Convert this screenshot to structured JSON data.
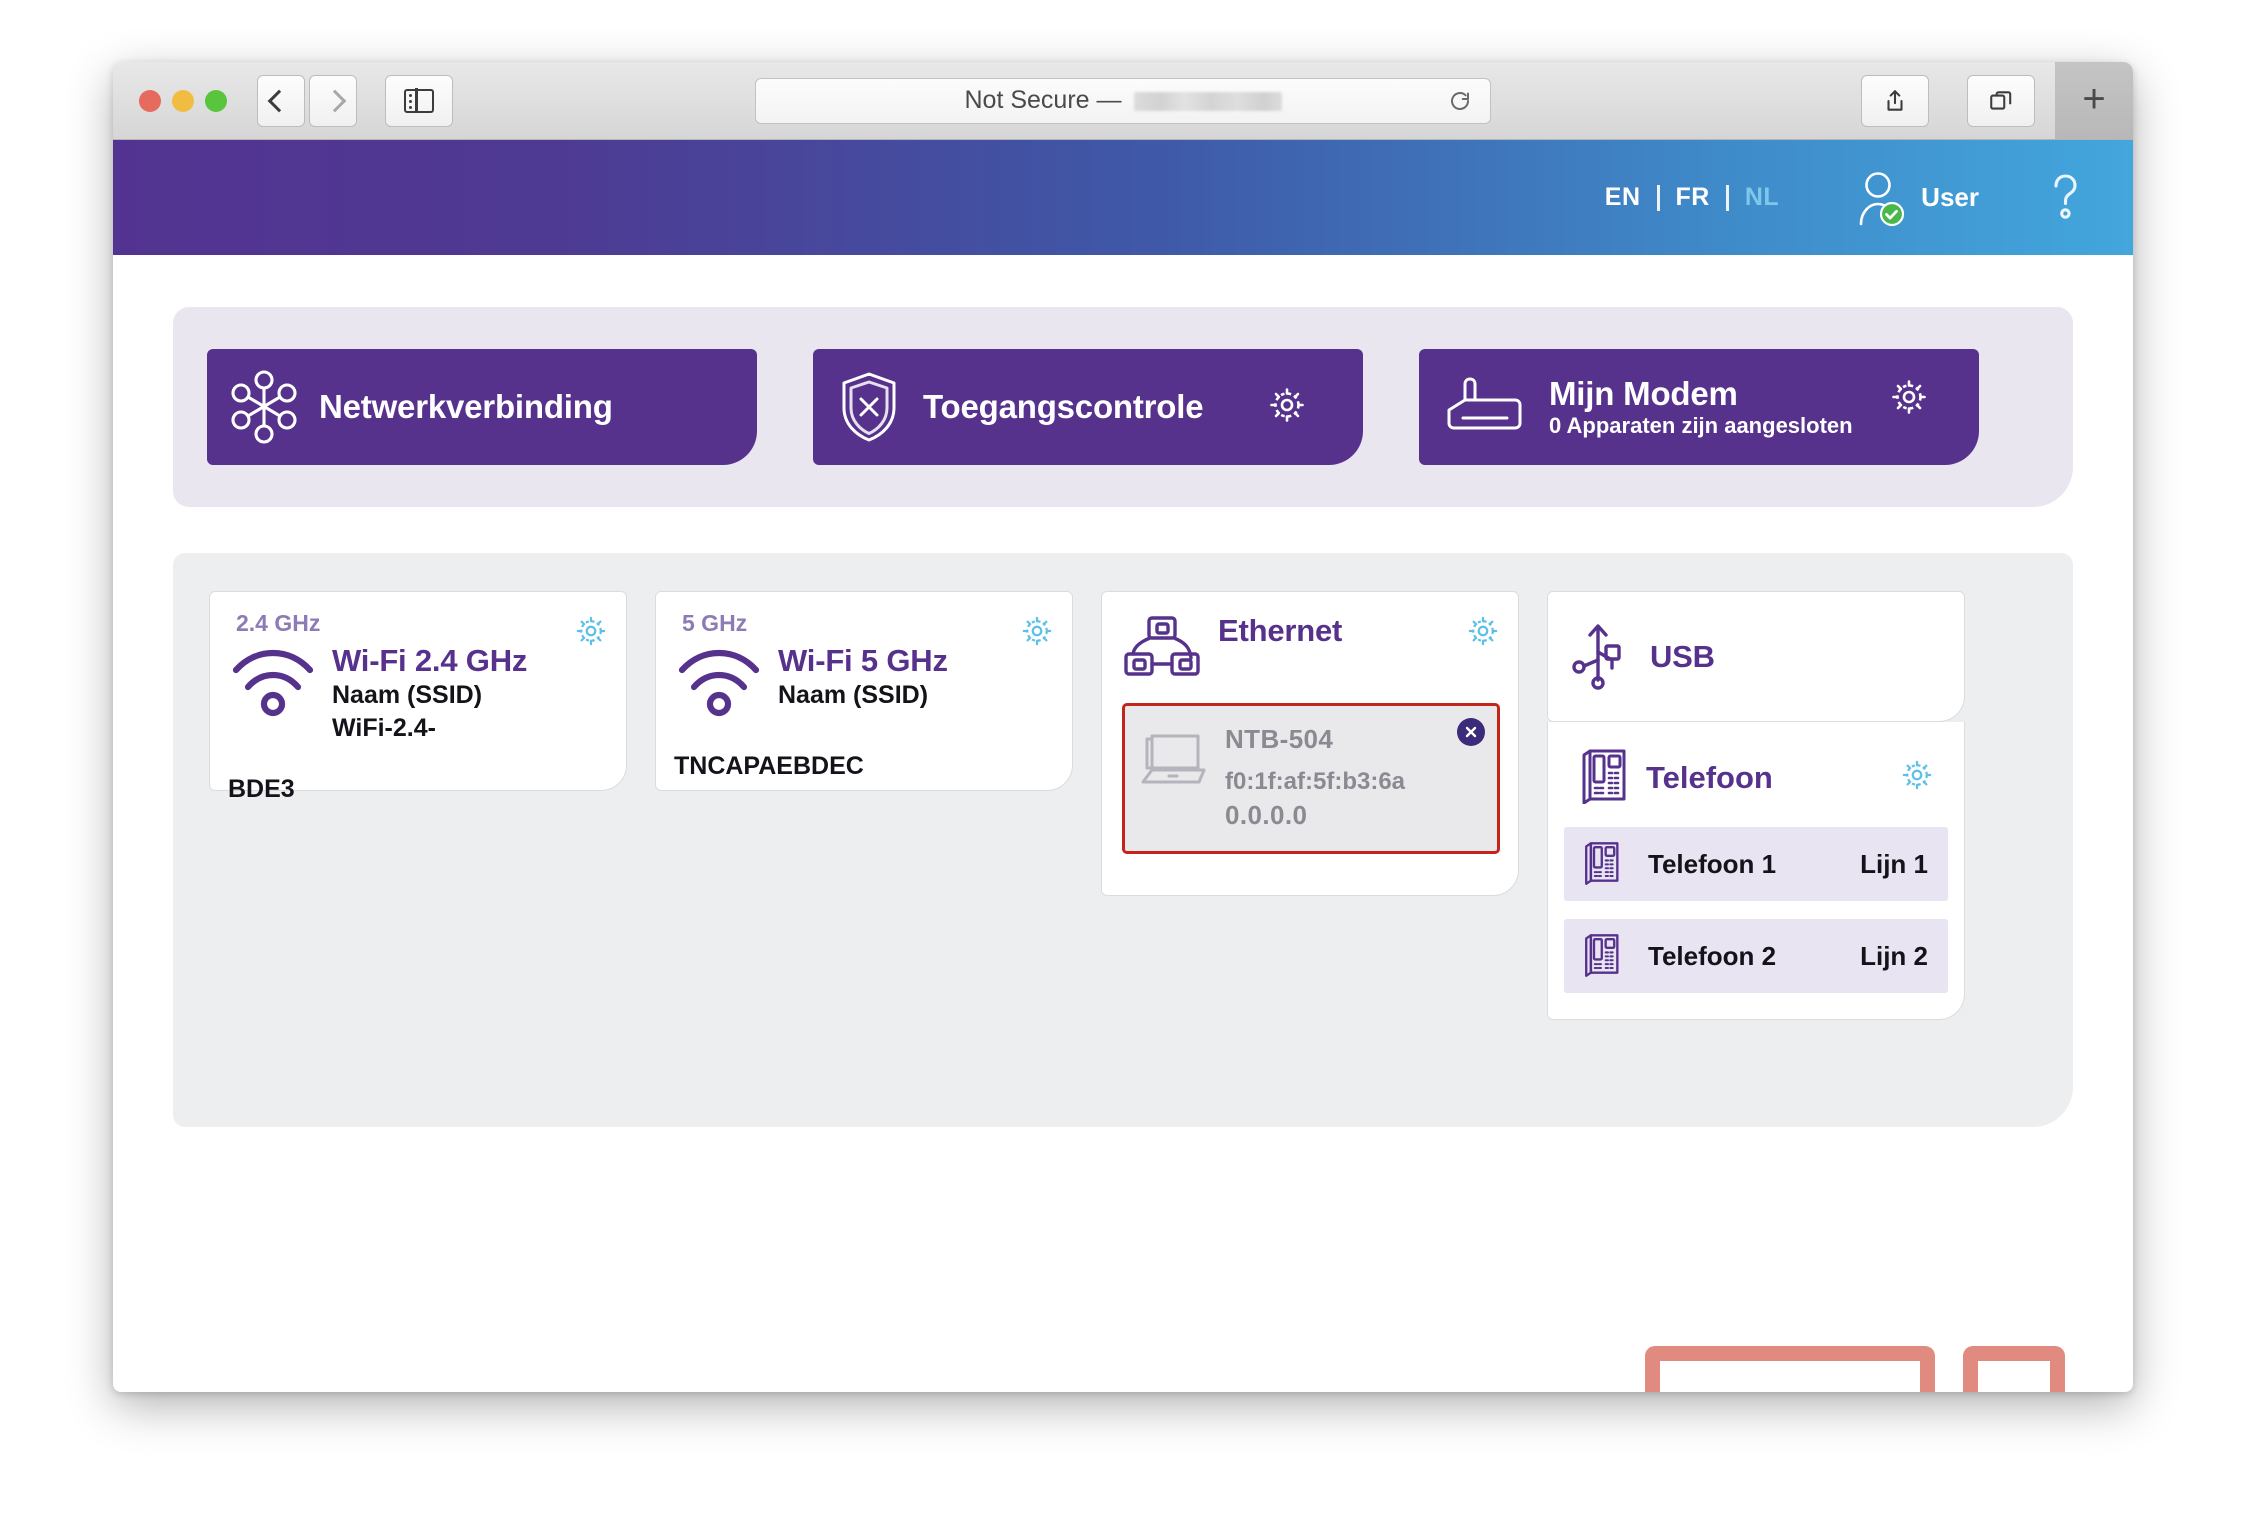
{
  "browser": {
    "url_prefix": "Not Secure —",
    "url_redacted": true,
    "back_icon": "chevron-left-icon",
    "forward_icon": "chevron-right-icon",
    "sidebar_icon": "sidebar-toggle-icon",
    "reload_icon": "reload-icon",
    "share_icon": "share-icon",
    "tabs_icon": "tab-overview-icon",
    "newtab_label": "+"
  },
  "header": {
    "languages": [
      {
        "code": "EN",
        "active": false
      },
      {
        "code": "FR",
        "active": false
      },
      {
        "code": "NL",
        "active": true
      }
    ],
    "user_label": "User",
    "user_icon": "user-avatar-icon",
    "user_status_icon": "check-badge-icon",
    "help_icon": "help-question-icon",
    "gradient_from": "#533391",
    "gradient_to": "#43a6dd"
  },
  "nav_cards": [
    {
      "title": "Netwerkverbinding",
      "subtitle": "",
      "icon": "network-topology-icon",
      "gear_icon": "gear-icon"
    },
    {
      "title": "Toegangscontrole",
      "subtitle": "",
      "icon": "shield-x-icon",
      "gear_icon": "gear-icon"
    },
    {
      "title": "Mijn Modem",
      "subtitle": "0 Apparaten zijn aangesloten",
      "icon": "modem-icon",
      "gear_icon": "gear-icon"
    }
  ],
  "interfaces": {
    "wifi24": {
      "band_label": "2.4 GHz",
      "title": "Wi-Fi 2.4 GHz",
      "ssid_label": "Naam (SSID)",
      "ssid_value_line1": "WiFi-2.4-",
      "ssid_value_line2": "BDE3",
      "icon": "wifi-icon",
      "gear_icon": "gear-icon"
    },
    "wifi5": {
      "band_label": "5 GHz",
      "title": "Wi-Fi 5 GHz",
      "ssid_label": "Naam (SSID)",
      "ssid_value_line1": "TNCAPAEBDEC",
      "icon": "wifi-icon",
      "gear_icon": "gear-icon"
    },
    "ethernet": {
      "title": "Ethernet",
      "icon": "ethernet-network-icon",
      "gear_icon": "gear-icon",
      "device": {
        "name": "NTB-504",
        "mac": "f0:1f:af:5f:b3:6a",
        "ip": "0.0.0.0",
        "icon": "laptop-icon",
        "close_icon": "close-circle-icon",
        "highlighted": true,
        "highlight_color": "#c4241a"
      }
    },
    "usb": {
      "title": "USB",
      "icon": "usb-icon"
    },
    "telefoon": {
      "title": "Telefoon",
      "icon": "desk-phone-icon",
      "gear_icon": "gear-icon",
      "highlight_color": "#e08a80",
      "lines": [
        {
          "name": "Telefoon 1",
          "label": "Lijn 1",
          "icon": "desk-phone-icon"
        },
        {
          "name": "Telefoon 2",
          "label": "Lijn 2",
          "icon": "desk-phone-icon"
        }
      ]
    }
  },
  "colors": {
    "brand_purple": "#56328c",
    "panel_lavender": "#e9e6f0",
    "panel_gray": "#edeef0",
    "gear_teal": "#5bc0e8",
    "annotation_salmon": "#e08a80",
    "device_highlight_red": "#c4241a"
  }
}
